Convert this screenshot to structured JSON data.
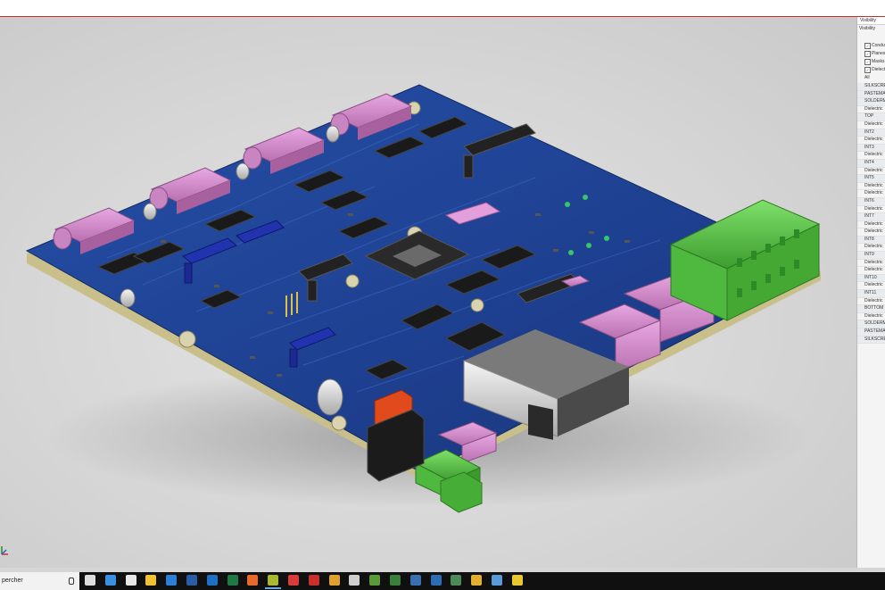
{
  "colors": {
    "board": "#1e3f8f",
    "board_dark": "#142d6a",
    "board_edge": "#c9bf8a",
    "connector_pink": "#d98fd2",
    "terminal_green": "#5dc94a",
    "accent_red": "#c9302c",
    "taskbar": "#101010"
  },
  "panel": {
    "tab_label": "Visibility",
    "sub_label": "Visibility",
    "options": [
      {
        "label": "Condu",
        "checked": true
      },
      {
        "label": "Planes",
        "checked": true
      },
      {
        "label": "Masks",
        "checked": true
      },
      {
        "label": "Dielect",
        "checked": true
      }
    ],
    "all_label": "All",
    "layers": [
      "SILKSCREE",
      "PASTEMAS",
      "SOLDERM",
      "Dielectric",
      "TOP",
      "Dielectric",
      "INT2",
      "Dielectric",
      "INT3",
      "Dielectric",
      "INT4",
      "Dielectric",
      "INT5",
      "Dielectric",
      "Dielectric",
      "INT6",
      "Dielectric",
      "INT7",
      "Dielectric",
      "Dielectric",
      "INT8",
      "Dielectric",
      "INT9",
      "Dielectric",
      "Dielectric",
      "INT10",
      "Dielectric",
      "INT11",
      "Dielectric",
      "BOTTOM",
      "Dielectric",
      "SOLDERM",
      "PASTEMAS",
      "SILKSCREE"
    ]
  },
  "taskbar": {
    "search_text": "percher",
    "icons": [
      {
        "name": "task-view-icon",
        "color": "#dddddd"
      },
      {
        "name": "edge-icon",
        "color": "#3b8fe0"
      },
      {
        "name": "store-icon",
        "color": "#e8e8e8"
      },
      {
        "name": "explorer-icon",
        "color": "#f2c232"
      },
      {
        "name": "mail-icon",
        "color": "#2d7fd6"
      },
      {
        "name": "word-icon",
        "color": "#2b5ca8"
      },
      {
        "name": "outlook-icon",
        "color": "#1f6fc2"
      },
      {
        "name": "excel-icon",
        "color": "#1e7a44"
      },
      {
        "name": "firefox-icon",
        "color": "#e8692a"
      },
      {
        "name": "altium-icon",
        "color": "#a9b832"
      },
      {
        "name": "record-icon",
        "color": "#d93b3b"
      },
      {
        "name": "pdf-icon",
        "color": "#c9302c"
      },
      {
        "name": "chart-icon",
        "color": "#e0a030"
      },
      {
        "name": "printer-icon",
        "color": "#cfcfcf"
      },
      {
        "name": "photos-icon",
        "color": "#5a9a3a"
      },
      {
        "name": "terminal-icon",
        "color": "#3a7f3a"
      },
      {
        "name": "network-icon",
        "color": "#3a6fb0"
      },
      {
        "name": "code-icon",
        "color": "#2d6db5"
      },
      {
        "name": "image-icon",
        "color": "#4d8a5a"
      },
      {
        "name": "chrome-icon",
        "color": "#e2b030"
      },
      {
        "name": "viewer-icon",
        "color": "#5a9ad9"
      },
      {
        "name": "pin-icon",
        "color": "#e8c830"
      }
    ]
  }
}
